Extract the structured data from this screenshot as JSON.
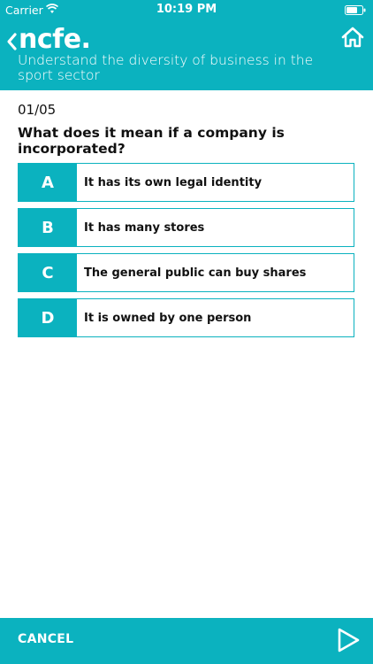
{
  "status_bar": {
    "carrier": "Carrier",
    "time": "10:19 PM"
  },
  "header": {
    "logo": "ncfe.",
    "subtitle": "Understand the diversity of business in the sport sector",
    "back_icon": "chevron-left-icon",
    "home_icon": "home-icon"
  },
  "quiz": {
    "counter": "01/05",
    "question": "What does it mean if a company is incorporated?",
    "options": [
      {
        "letter": "A",
        "text": "It has its own legal identity"
      },
      {
        "letter": "B",
        "text": "It has many stores"
      },
      {
        "letter": "C",
        "text": "The general public can buy shares"
      },
      {
        "letter": "D",
        "text": "It is owned by one person"
      }
    ]
  },
  "footer": {
    "cancel_label": "CANCEL",
    "next_icon": "play-triangle-icon"
  },
  "colors": {
    "accent": "#0bb2bf",
    "text": "#111111",
    "background": "#ffffff"
  }
}
